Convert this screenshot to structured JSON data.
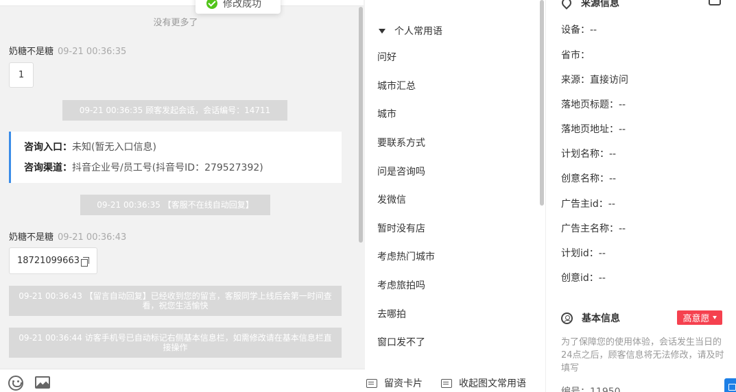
{
  "toast": {
    "text": "修改成功"
  },
  "chat": {
    "no_more": "没有更多了",
    "messages": [
      {
        "sender": "奶糖不是糖",
        "time": "09-21 00:36:35",
        "content": "1"
      },
      {
        "system": "09-21 00:36:35 顾客发起会话，会话编号：14711"
      },
      {
        "entry_label": "咨询入口：",
        "entry_value": "未知(暂无入口信息)",
        "channel_label": "咨询渠道：",
        "channel_value": "抖音企业号/员工号(抖音号ID：279527392)"
      },
      {
        "system": "09-21 00:36:35 【客服不在线自动回复】"
      },
      {
        "sender": "奶糖不是糖",
        "time": "09-21 00:36:43",
        "content": "18721099663"
      },
      {
        "system": "09-21 00:36:43 【留言自动回复】已经收到您的留言，客服同学上线后会第一时间查看，祝您生活愉快"
      },
      {
        "system": "09-21 00:36:44 访客手机号已自动标记右侧基本信息栏，如需修改请在基本信息栏直接操作"
      }
    ]
  },
  "phrases": {
    "group": "个人常用语",
    "items": [
      "问好",
      "城市汇总",
      "城市",
      "要联系方式",
      "问是咨询吗",
      "发微信",
      "暂时没有店",
      "考虑热门城市",
      "考虑旅拍吗",
      "去哪拍",
      "窗口发不了"
    ],
    "footer_card": "留资卡片",
    "footer_collapse": "收起图文常用语"
  },
  "source_info": {
    "title": "来源信息",
    "fields": [
      "设备：--",
      "省市：",
      "来源：直接访问",
      "落地页标题：--",
      "落地页地址：--",
      "计划名称：--",
      "创意名称：--",
      "广告主id：--",
      "广告主名称：--",
      "计划id：--",
      "创意id：--"
    ]
  },
  "basic_info": {
    "title": "基本信息",
    "intent_badge": "高意愿",
    "notice": "为了保障您的使用体验，会话发生当日的24点之后，顾客信息将无法修改，请及时填写",
    "partial_field": "编号：11950"
  },
  "colors": {
    "accent": "#3b8ce8",
    "badge": "#f5414f",
    "success": "#52c41a"
  }
}
